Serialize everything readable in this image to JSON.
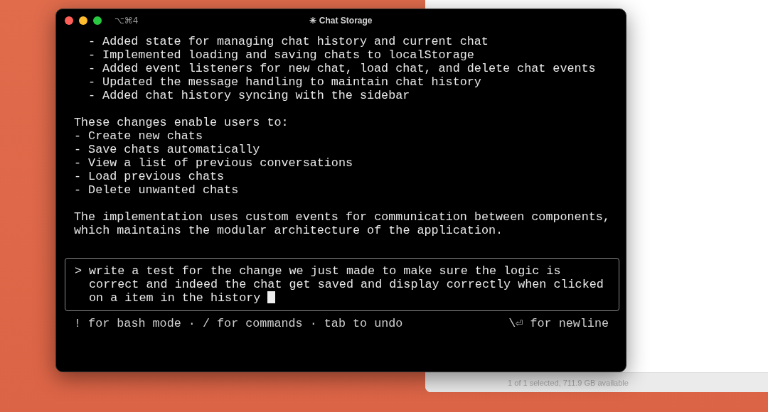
{
  "finder_window": {
    "status_bar": "1 of 1 selected, 711.9 GB available"
  },
  "terminal": {
    "shortcut": "⌥⌘4",
    "title": "✳ Chat Storage",
    "output": [
      {
        "indented": true,
        "lines": [
          "- Added state for managing chat history and current chat",
          "- Implemented loading and saving chats to localStorage",
          "- Added event listeners for new chat, load chat, and delete chat events",
          "- Updated the message handling to maintain chat history",
          "- Added chat history syncing with the sidebar"
        ]
      },
      {
        "indented": false,
        "lines": [
          "These changes enable users to:",
          "- Create new chats",
          "- Save chats automatically",
          "- View a list of previous conversations",
          "- Load previous chats",
          "- Delete unwanted chats"
        ]
      },
      {
        "indented": false,
        "lines": [
          "The implementation uses custom events for communication between components,",
          "which maintains the modular architecture of the application."
        ]
      }
    ],
    "prompt": {
      "symbol": ">",
      "lines": [
        "write a test for the change we just made to make sure the logic is",
        "correct and indeed the chat get saved and display correctly when clicked",
        "on a item in the history"
      ]
    },
    "hints": {
      "left": "! for bash mode · / for commands · tab to undo",
      "right": "\\⏎ for newline"
    }
  }
}
